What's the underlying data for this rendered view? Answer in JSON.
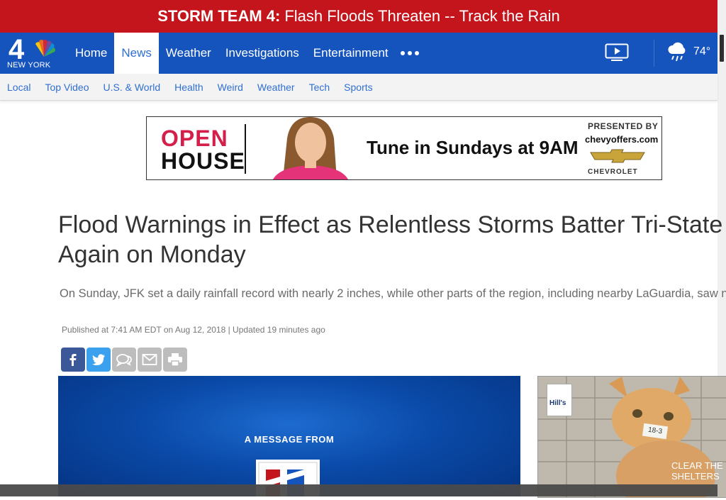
{
  "banner": {
    "bold": "STORM TEAM 4:",
    "text": "Flash Floods Threaten -- Track the Rain"
  },
  "logo": {
    "channel": "4",
    "city": "NEW YORK"
  },
  "nav": {
    "items": [
      {
        "label": "Home"
      },
      {
        "label": "News"
      },
      {
        "label": "Weather"
      },
      {
        "label": "Investigations"
      },
      {
        "label": "Entertainment"
      }
    ],
    "active": "News",
    "more_icon": "more-dots-icon",
    "tv_icon": "tv-play-icon"
  },
  "weather": {
    "icon": "rain-cloud-icon",
    "temp": "74°"
  },
  "subnav": {
    "items": [
      {
        "label": "Local"
      },
      {
        "label": "Top Video"
      },
      {
        "label": "U.S. & World"
      },
      {
        "label": "Health"
      },
      {
        "label": "Weird"
      },
      {
        "label": "Weather"
      },
      {
        "label": "Tech"
      },
      {
        "label": "Sports"
      }
    ]
  },
  "ad": {
    "open": "OPEN",
    "house": "HOUSE",
    "tune": "Tune in Sundays at 9AM",
    "presented": "PRESENTED BY",
    "offers": "chevyoffers.com",
    "brand": "CHEVROLET"
  },
  "article": {
    "headline": "Flood Warnings in Effect as Relentless Storms Batter Tri-State Again on Monday",
    "subhead": "On Sunday, JFK set a daily rainfall record with nearly 2 inches, while other parts of the region, including nearby LaGuardia, saw none",
    "published": "Published at 7:41 AM EDT on Aug 12, 2018 | Updated 19 minutes ago"
  },
  "share": {
    "icons": [
      "facebook-icon",
      "twitter-icon",
      "comment-icon",
      "email-icon",
      "print-icon"
    ]
  },
  "video": {
    "message": "A MESSAGE FROM"
  },
  "side_ad": {
    "brand": "Hill's",
    "tag": "18-3",
    "campaign": "CLEAR THE SHELTERS"
  },
  "colors": {
    "brand_red": "#c4151c",
    "nav_blue": "#1553bd",
    "link_blue": "#2f6fd2"
  }
}
